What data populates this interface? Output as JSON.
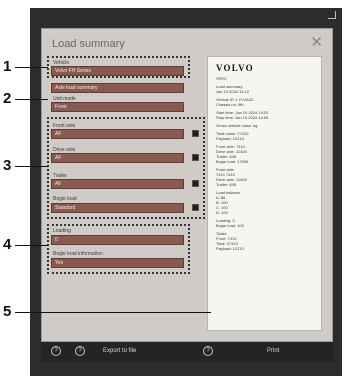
{
  "dialog": {
    "title": "Load summary",
    "close_icon": "close-icon"
  },
  "callouts": [
    "1",
    "2",
    "3",
    "4",
    "5"
  ],
  "fields": {
    "f1_label": "Vehicle",
    "f1_value": "Volvo FH Series",
    "f2_label": "Axle load summary",
    "f3_label": "Unit mode",
    "f3_value": "Front",
    "f4_label": "Front axle",
    "f4_value": "All",
    "f5_label": "Drive axle",
    "f5_value": "All",
    "f6_label": "Trailer",
    "f6_value": "All",
    "f7_label": "Bogie load",
    "f7_value": "Standard",
    "f8_label": "Loading",
    "f8_value": "0",
    "f9_label": "Bogie load information",
    "f9_value": "Yes"
  },
  "preview": {
    "logo": "VOLVO",
    "lines": [
      "SPEC",
      "",
      "Load summary",
      "Jan 10 2024 14:12",
      "",
      "Vehicle ID 1 YV2A4C",
      "Chassis no: 4th",
      "",
      "Start time: Jan 10 2024 14:02",
      "Stop time: Jan 10 2024 14:09",
      "",
      "Gross vehicle mass: kg",
      "",
      "Total mass: 27410",
      "Payload: 12210",
      "",
      "Front axle: 7410",
      "Drive axle: 11400",
      "Trailer: 845",
      "Bogie load: 17090",
      "",
      "Front axle",
      "7410  7410",
      "Drive axle: 11400",
      "Trailer: 845",
      "",
      "Load balance",
      "A: 86",
      "B: 100",
      "C: 100",
      "D: 100",
      "",
      "Loading: 0",
      "Bogie load: 100",
      "",
      "Totals",
      "Front: 7410",
      "Total: 27410",
      "Payload: 12210"
    ]
  },
  "toolbar": {
    "help_icon_1": "?",
    "help_icon_2": "?",
    "export_label": "Export to file",
    "help_icon_3": "?",
    "print_label": "Print"
  }
}
